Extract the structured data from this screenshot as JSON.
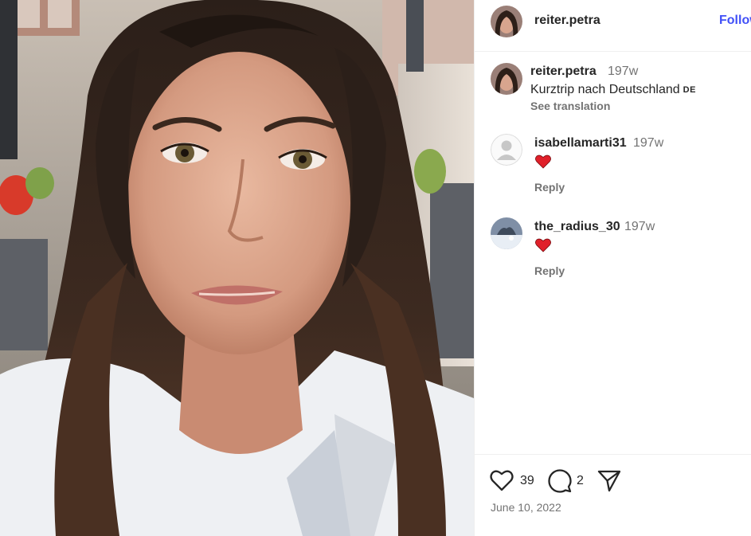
{
  "header": {
    "username": "reiter.petra",
    "follow_label": "Follow"
  },
  "caption": {
    "username": "reiter.petra",
    "time": "197w",
    "text": "Kurztrip nach Deutschland",
    "flag": "DE",
    "see_translation": "See translation"
  },
  "comments": [
    {
      "username": "isabellamarti31",
      "time": "197w",
      "emoji": "heart",
      "reply_label": "Reply"
    },
    {
      "username": "the_radius_30",
      "time": "197w",
      "emoji": "heart",
      "reply_label": "Reply"
    }
  ],
  "actions": {
    "like_icon": "heart-outline-icon",
    "likes": "39",
    "comment_icon": "comment-bubble-icon",
    "comments": "2",
    "share_icon": "paper-plane-icon"
  },
  "post_date": "June 10, 2022",
  "colors": {
    "follow_link": "#4150f7",
    "secondary_text": "#737373",
    "emoji_heart": "#e0202a"
  }
}
